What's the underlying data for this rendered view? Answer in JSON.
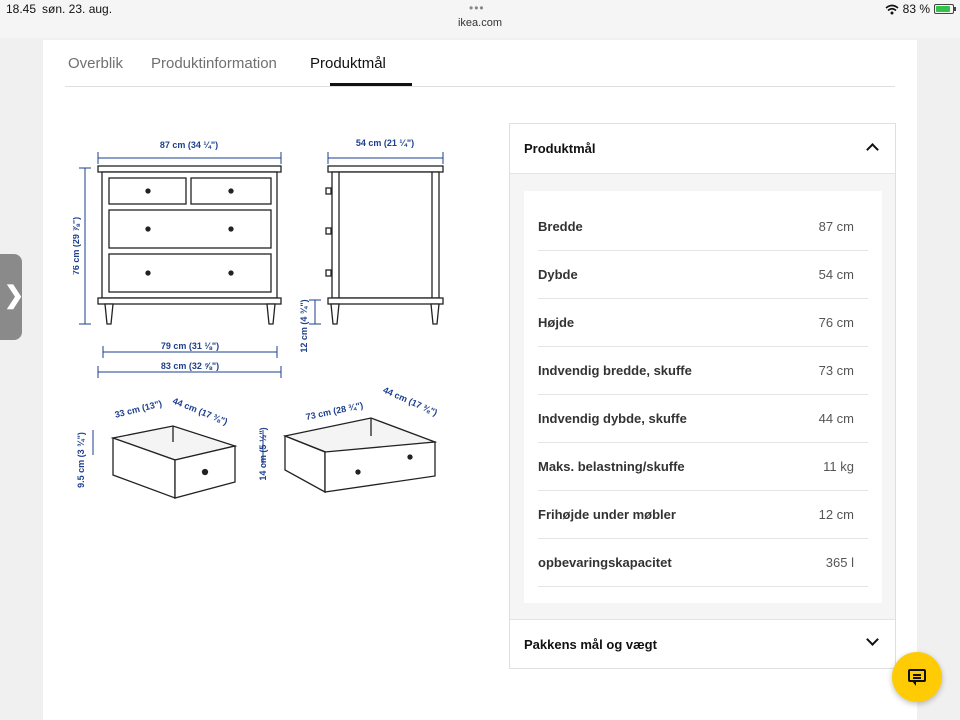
{
  "status_bar": {
    "time": "18.45",
    "date": "søn. 23. aug.",
    "dots": "•••",
    "url": "ikea.com",
    "battery_text": "83 %"
  },
  "tabs": [
    {
      "label": "Overblik",
      "active": false
    },
    {
      "label": "Produktinformation",
      "active": false
    },
    {
      "label": "Produktmål",
      "active": true
    }
  ],
  "diagram": {
    "width_top": "87 cm (34 ¼\")",
    "depth_top": "54 cm (21 ¼\")",
    "height_side": "76 cm (29 ⅞\")",
    "inner_width": "79 cm (31 ⅛\")",
    "base_width": "83 cm (32 ⅝\")",
    "clearance": "12 cm (4 ¾\")",
    "small_drawer_width": "33 cm (13\")",
    "small_drawer_depth": "44 cm (17 ⅜\")",
    "small_drawer_height": "9.5 cm (3 ¾\")",
    "large_drawer_width": "73 cm (28 ¾\")",
    "large_drawer_depth": "44 cm (17 ⅜\")",
    "large_drawer_height": "14 cm (5 ½\")"
  },
  "panel": {
    "title": "Produktmål",
    "rows": [
      {
        "label": "Bredde",
        "value": "87 cm"
      },
      {
        "label": "Dybde",
        "value": "54 cm"
      },
      {
        "label": "Højde",
        "value": "76 cm"
      },
      {
        "label": "Indvendig bredde, skuffe",
        "value": "73 cm"
      },
      {
        "label": "Indvendig dybde, skuffe",
        "value": "44 cm"
      },
      {
        "label": "Maks. belastning/skuffe",
        "value": "11 kg"
      },
      {
        "label": "Frihøjde under møbler",
        "value": "12 cm"
      },
      {
        "label": "opbevaringskapacitet",
        "value": "365 l"
      }
    ],
    "footer_title": "Pakkens mål og vægt"
  },
  "side_handle_glyph": "❯",
  "colors": {
    "accent": "#ffcb05",
    "diagram_label": "#1d3f8f"
  }
}
